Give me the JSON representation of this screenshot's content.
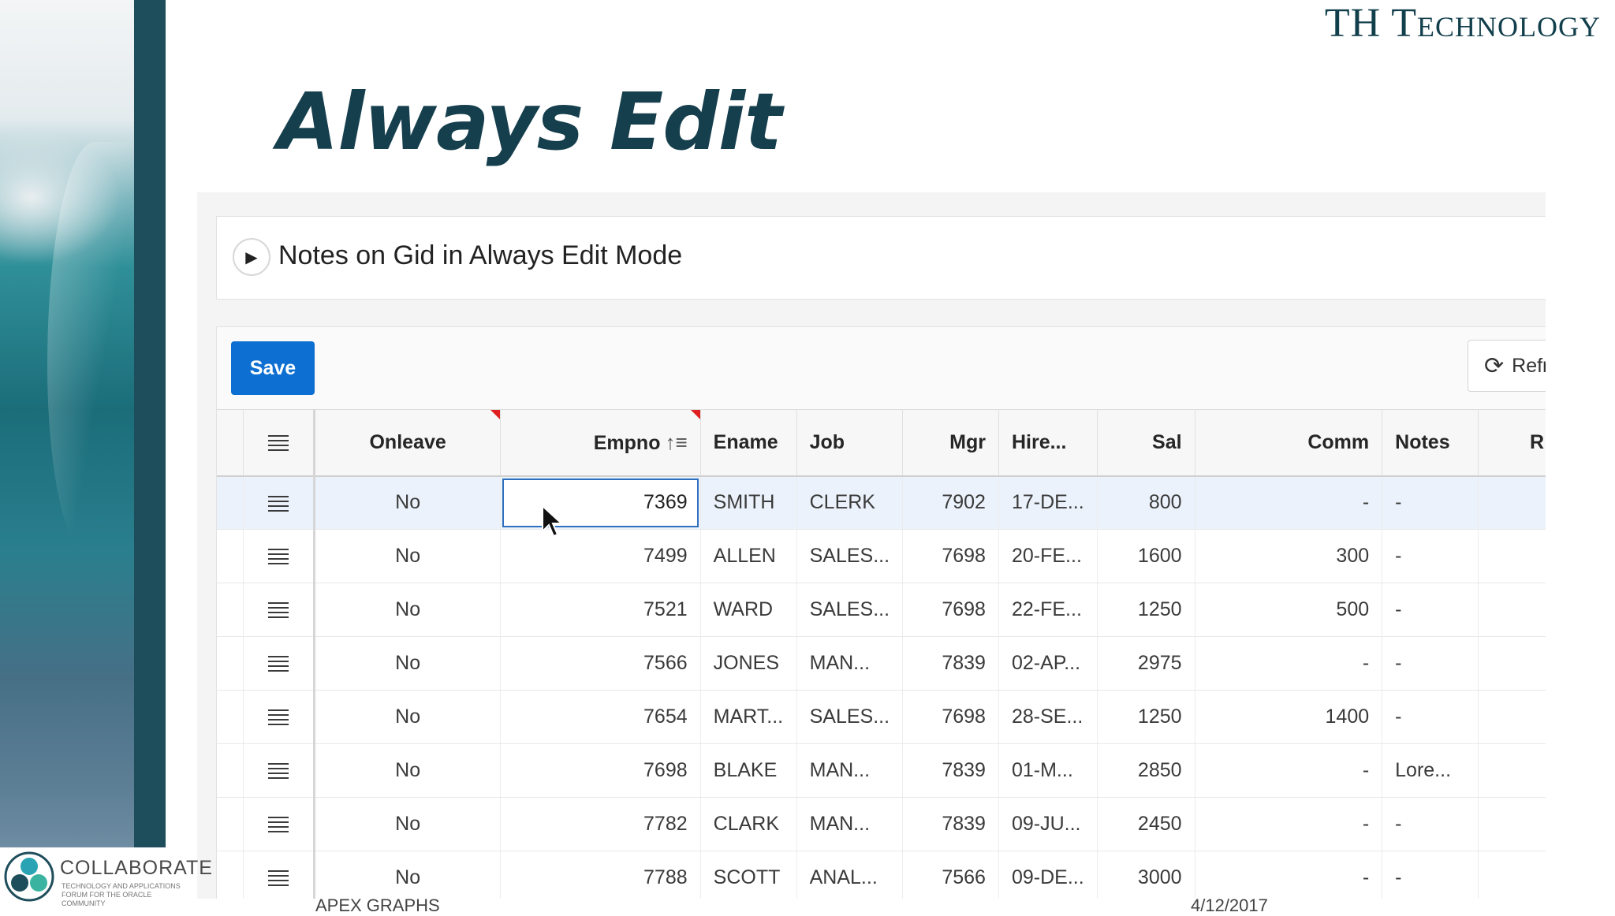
{
  "slide": {
    "brand": "TH Technology",
    "title": "Always Edit",
    "footer_left": "APEX GRAPHS",
    "footer_right": "4/12/2017"
  },
  "logo": {
    "name": "COLLABORATE",
    "tagline": "TECHNOLOGY AND APPLICATIONS FORUM FOR THE ORACLE COMMUNITY"
  },
  "region": {
    "title": "Notes on Gid in Always Edit Mode",
    "toggle_icon": "triangle-right-icon"
  },
  "toolbar": {
    "save_label": "Save",
    "refresh_label": "Refresh",
    "refresh_icon": "refresh-icon",
    "save_color": "#0c6fd1"
  },
  "grid": {
    "columns": [
      "Onleave",
      "Empno",
      "Ename",
      "Job",
      "Mgr",
      "Hire...",
      "Sal",
      "Comm",
      "Notes",
      "R"
    ],
    "sort_column": "Empno",
    "sort_direction": "ascending",
    "editing_value": "7369",
    "rows": [
      {
        "onleave": "No",
        "empno": "7369",
        "ename": "SMITH",
        "job": "CLERK",
        "mgr": "7902",
        "hire": "17-DE...",
        "sal": "800",
        "comm": "-",
        "notes": "-"
      },
      {
        "onleave": "No",
        "empno": "7499",
        "ename": "ALLEN",
        "job": "SALES...",
        "mgr": "7698",
        "hire": "20-FE...",
        "sal": "1600",
        "comm": "300",
        "notes": "-"
      },
      {
        "onleave": "No",
        "empno": "7521",
        "ename": "WARD",
        "job": "SALES...",
        "mgr": "7698",
        "hire": "22-FE...",
        "sal": "1250",
        "comm": "500",
        "notes": "-"
      },
      {
        "onleave": "No",
        "empno": "7566",
        "ename": "JONES",
        "job": "MAN...",
        "mgr": "7839",
        "hire": "02-AP...",
        "sal": "2975",
        "comm": "-",
        "notes": "-"
      },
      {
        "onleave": "No",
        "empno": "7654",
        "ename": "MART...",
        "job": "SALES...",
        "mgr": "7698",
        "hire": "28-SE...",
        "sal": "1250",
        "comm": "1400",
        "notes": "-"
      },
      {
        "onleave": "No",
        "empno": "7698",
        "ename": "BLAKE",
        "job": "MAN...",
        "mgr": "7839",
        "hire": "01-M...",
        "sal": "2850",
        "comm": "-",
        "notes": "Lore..."
      },
      {
        "onleave": "No",
        "empno": "7782",
        "ename": "CLARK",
        "job": "MAN...",
        "mgr": "7839",
        "hire": "09-JU...",
        "sal": "2450",
        "comm": "-",
        "notes": "-"
      },
      {
        "onleave": "No",
        "empno": "7788",
        "ename": "SCOTT",
        "job": "ANAL...",
        "mgr": "7566",
        "hire": "09-DE...",
        "sal": "3000",
        "comm": "-",
        "notes": "-"
      }
    ]
  }
}
